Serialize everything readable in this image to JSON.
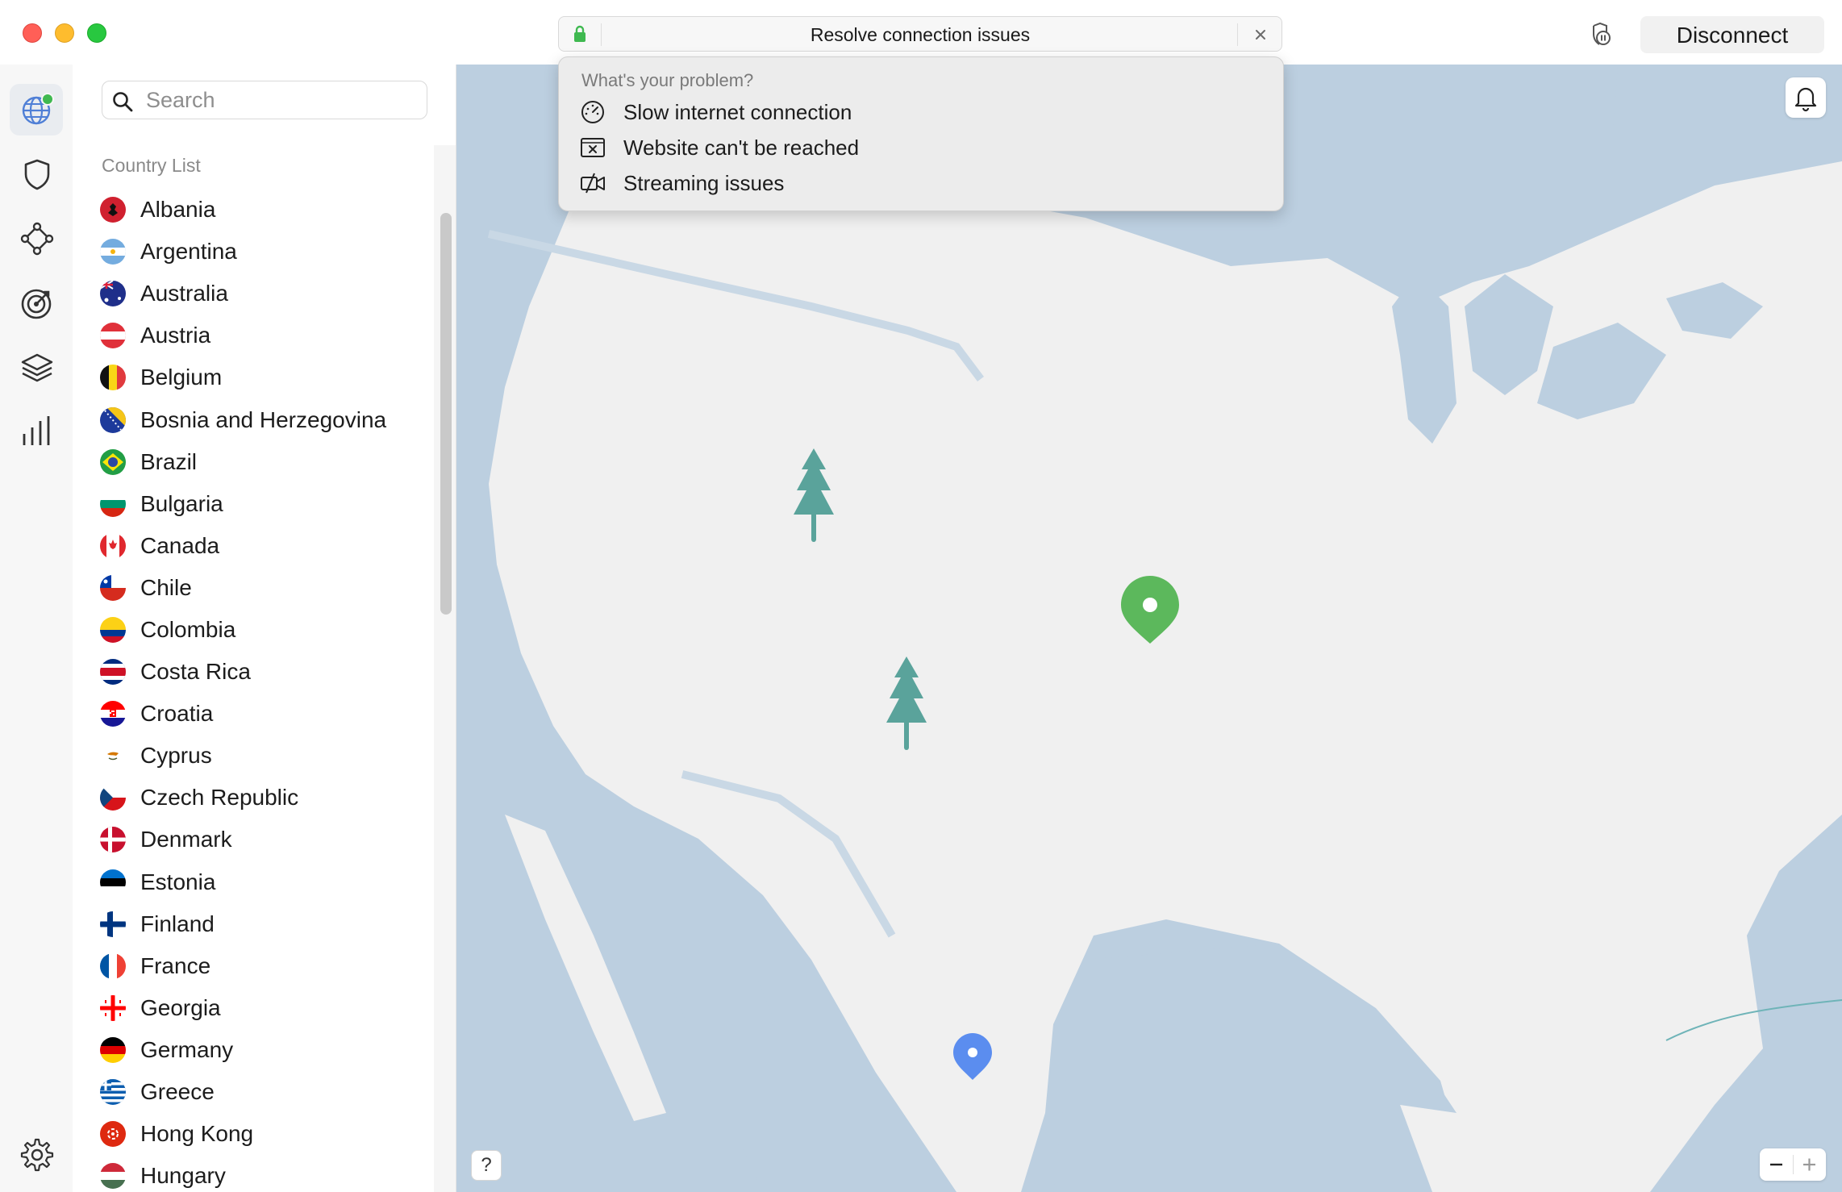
{
  "header": {
    "resolve_title": "Resolve connection issues",
    "disconnect_label": "Disconnect"
  },
  "problem_menu": {
    "heading": "What's your problem?",
    "items": [
      {
        "label": "Slow internet connection",
        "icon": "speedometer-icon"
      },
      {
        "label": "Website can't be reached",
        "icon": "browser-error-icon"
      },
      {
        "label": "Streaming issues",
        "icon": "video-off-icon"
      }
    ]
  },
  "rail": {
    "items": [
      "globe-icon",
      "shield-icon",
      "meshnet-icon",
      "target-icon",
      "layers-icon",
      "stats-icon"
    ],
    "bottom": "settings-icon"
  },
  "search": {
    "placeholder": "Search",
    "value": ""
  },
  "country_list": {
    "heading": "Country List",
    "countries": [
      "Albania",
      "Argentina",
      "Australia",
      "Austria",
      "Belgium",
      "Bosnia and Herzegovina",
      "Brazil",
      "Bulgaria",
      "Canada",
      "Chile",
      "Colombia",
      "Costa Rica",
      "Croatia",
      "Cyprus",
      "Czech Republic",
      "Denmark",
      "Estonia",
      "Finland",
      "France",
      "Georgia",
      "Germany",
      "Greece",
      "Hong Kong",
      "Hungary"
    ]
  },
  "map": {
    "help_label": "?",
    "zoom_out_label": "−",
    "zoom_in_label": "+"
  },
  "colors": {
    "water": "#bccfe0",
    "land": "#f0f0f0",
    "accent_green": "#5cb85c",
    "pin_blue": "#5b8def",
    "tree": "#5aa39b"
  }
}
